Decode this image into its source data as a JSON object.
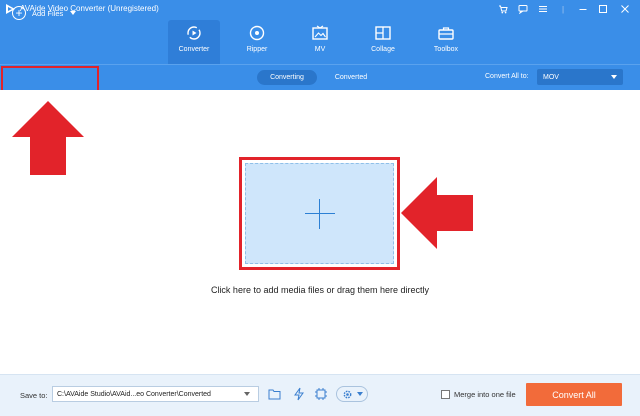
{
  "app": {
    "title": "AVAide Video Converter (Unregistered)"
  },
  "window_controls": [
    {
      "name": "cart-icon"
    },
    {
      "name": "feedback-icon"
    },
    {
      "name": "menu-icon"
    },
    {
      "name": "minimize-icon"
    },
    {
      "name": "maximize-icon"
    },
    {
      "name": "close-icon"
    }
  ],
  "tabs": [
    {
      "label": "Converter",
      "icon": "converter-icon",
      "active": true
    },
    {
      "label": "Ripper",
      "icon": "ripper-icon",
      "active": false
    },
    {
      "label": "MV",
      "icon": "mv-icon",
      "active": false
    },
    {
      "label": "Collage",
      "icon": "collage-icon",
      "active": false
    },
    {
      "label": "Toolbox",
      "icon": "toolbox-icon",
      "active": false
    }
  ],
  "subbar": {
    "add_files_label": "Add Files",
    "segments": [
      "Converting",
      "Converted"
    ],
    "convert_all_label": "Convert All to:",
    "format_value": "MOV"
  },
  "main": {
    "hint": "Click here to add media files or drag them here directly"
  },
  "bottom": {
    "save_label": "Save to:",
    "path_value": "C:\\AVAide Studio\\AVAid...eo Converter\\Converted",
    "merge_label": "Merge into one file",
    "merge_checked": false,
    "convert_all_button": "Convert All"
  },
  "colors": {
    "primary": "#3a8ee8",
    "annotation_red": "#e2232a",
    "convert_button": "#f26b3a",
    "drop_zone": "#cfe6fb"
  }
}
